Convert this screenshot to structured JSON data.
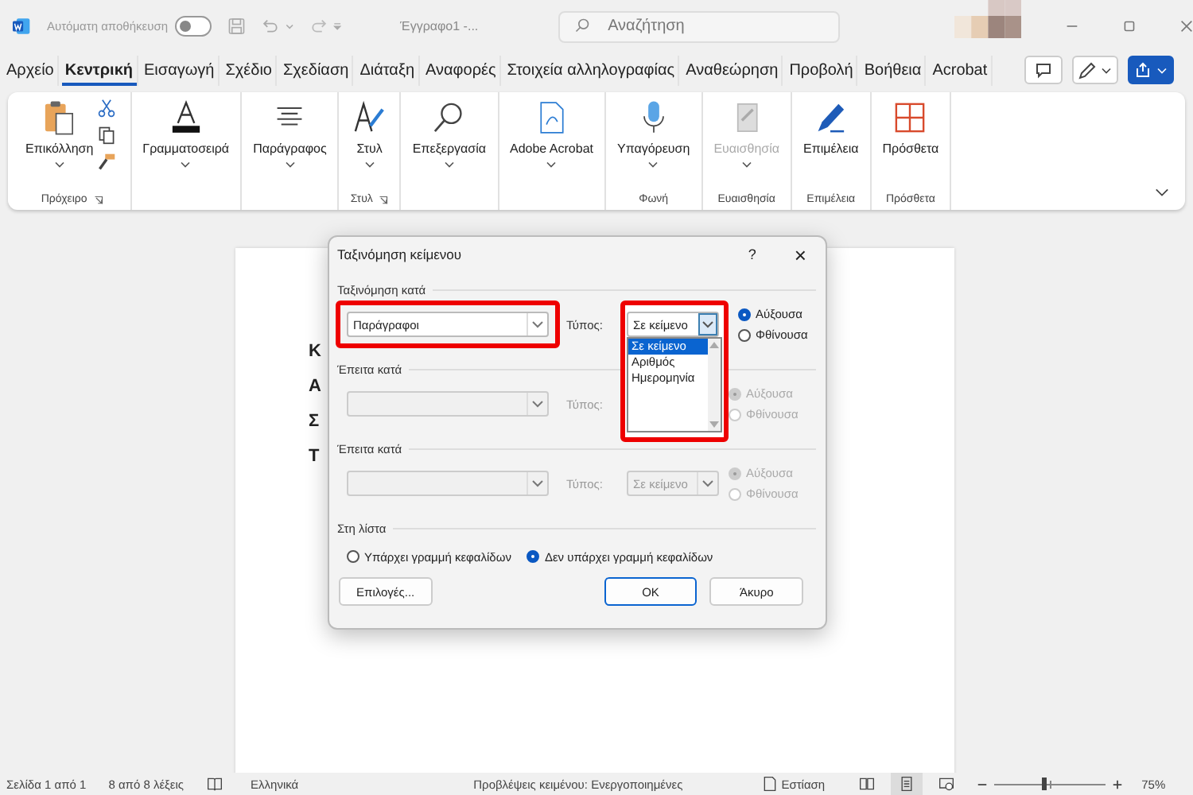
{
  "title_bar": {
    "autosave": {
      "label": "Αυτόματη αποθήκευση",
      "on": false
    },
    "document_title": "Έγγραφο1 -...",
    "search": {
      "placeholder": "Αναζήτηση"
    }
  },
  "menu_tabs": [
    {
      "label": "Αρχείο",
      "selected": false
    },
    {
      "label": "Κεντρική",
      "selected": true
    },
    {
      "label": "Εισαγωγή",
      "selected": false
    },
    {
      "label": "Σχέδιο",
      "selected": false
    },
    {
      "label": "Σχεδίαση",
      "selected": false
    },
    {
      "label": "Διάταξη",
      "selected": false
    },
    {
      "label": "Αναφορές",
      "selected": false
    },
    {
      "label": "Στοιχεία αλληλογραφίας",
      "selected": false
    },
    {
      "label": "Αναθεώρηση",
      "selected": false
    },
    {
      "label": "Προβολή",
      "selected": false
    },
    {
      "label": "Βοήθεια",
      "selected": false
    },
    {
      "label": "Acrobat",
      "selected": false
    }
  ],
  "ribbon": [
    {
      "label": "Επικόλληση",
      "dropdown": true,
      "disabled": false,
      "caption": "Πρόχειρο",
      "launcher": true
    },
    {
      "label": "Γραμματοσειρά",
      "dropdown": true,
      "disabled": false
    },
    {
      "label": "Παράγραφος",
      "dropdown": true,
      "disabled": false
    },
    {
      "label": "Στυλ",
      "dropdown": true,
      "disabled": false,
      "caption": "Στυλ",
      "launcher": true
    },
    {
      "label": "Επεξεργασία",
      "dropdown": true,
      "disabled": false
    },
    {
      "label": "Adobe Acrobat",
      "dropdown": true,
      "disabled": false
    },
    {
      "label": "Υπαγόρευση",
      "dropdown": true,
      "disabled": false,
      "caption": "Φωνή"
    },
    {
      "label": "Ευαισθησία",
      "dropdown": true,
      "disabled": true,
      "caption": "Ευαισθησία"
    },
    {
      "label": "Επιμέλεια",
      "disabled": false,
      "caption": "Επιμέλεια"
    },
    {
      "label": "Πρόσθετα",
      "disabled": false,
      "caption": "Πρόσθετα"
    }
  ],
  "document": {
    "lines": [
      "Κ",
      "Α",
      "Σ",
      "Τ"
    ]
  },
  "dialog": {
    "title": "Ταξινόμηση κείμενου",
    "help": "?",
    "close": "×",
    "sort_rows": [
      {
        "heading": "Ταξινόμηση κατά",
        "value": "Παράγραφοι",
        "type_label": "Τύπος:",
        "type_value": "Σε κείμενο",
        "disabled": false,
        "highlighted": true,
        "dropdown_open": true,
        "options": [
          {
            "label": "Σε κείμενο",
            "selected": true
          },
          {
            "label": "Αριθμός",
            "selected": false
          },
          {
            "label": "Ημερομηνία",
            "selected": false
          }
        ],
        "order": [
          {
            "label": "Αύξουσα",
            "selected": true
          },
          {
            "label": "Φθίνουσα",
            "selected": false
          }
        ]
      },
      {
        "heading": "Έπειτα κατά",
        "type_label": "Τύπος:",
        "disabled": true,
        "order": [
          {
            "label": "Αύξουσα",
            "selected": true
          },
          {
            "label": "Φθίνουσα",
            "selected": false
          }
        ]
      },
      {
        "heading": "Έπειτα κατά",
        "type_label": "Τύπος:",
        "type_value": "Σε κείμενο",
        "disabled": true,
        "order": [
          {
            "label": "Αύξουσα",
            "selected": true
          },
          {
            "label": "Φθίνουσα",
            "selected": false
          }
        ]
      }
    ],
    "list": {
      "heading": "Στη λίστα",
      "options": [
        {
          "label": "Υπάρχει γραμμή κεφαλίδων",
          "selected": false
        },
        {
          "label": "Δεν υπάρχει γραμμή κεφαλίδων",
          "selected": true
        }
      ]
    },
    "buttons": [
      {
        "label": "Επιλογές...",
        "default": false
      },
      {
        "label": "OK",
        "default": true
      },
      {
        "label": "Άκυρο",
        "default": false
      }
    ]
  },
  "status_bar": {
    "page": "Σελίδα 1 από 1",
    "words": "8 από 8 λέξεις",
    "language": "Ελληνικά",
    "predictions": "Προβλέψεις κειμένου: Ενεργοποιημένες",
    "focus": "Εστίαση",
    "views": [
      {
        "selected": false
      },
      {
        "selected": true
      },
      {
        "selected": false
      }
    ],
    "zoom": {
      "level": 0.45,
      "reading": "75%"
    }
  }
}
